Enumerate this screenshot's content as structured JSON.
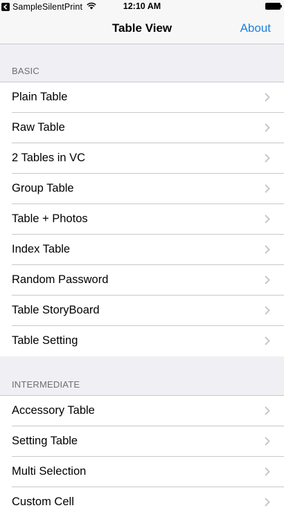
{
  "status_bar": {
    "app_name": "SampleSilentPrint",
    "time": "12:10 AM"
  },
  "nav": {
    "title": "Table View",
    "right_button": "About"
  },
  "sections": [
    {
      "header": "BASIC",
      "items": [
        {
          "label": "Plain Table"
        },
        {
          "label": "Raw Table"
        },
        {
          "label": "2 Tables in VC"
        },
        {
          "label": "Group Table"
        },
        {
          "label": "Table + Photos"
        },
        {
          "label": "Index Table"
        },
        {
          "label": "Random Password"
        },
        {
          "label": "Table StoryBoard"
        },
        {
          "label": "Table Setting"
        }
      ]
    },
    {
      "header": "INTERMEDIATE",
      "items": [
        {
          "label": "Accessory Table"
        },
        {
          "label": "Setting Table"
        },
        {
          "label": "Multi Selection"
        },
        {
          "label": "Custom Cell"
        }
      ]
    }
  ],
  "colors": {
    "accent": "#1a82e2",
    "background": "#efeff4",
    "separator": "#c8c7cc",
    "section_header_text": "#6d6d72",
    "chevron": "#c7c7cc"
  },
  "icons": {
    "back_app": "back-to-app-icon",
    "wifi": "wifi-icon",
    "battery": "battery-icon",
    "disclosure": "chevron-right-icon"
  }
}
